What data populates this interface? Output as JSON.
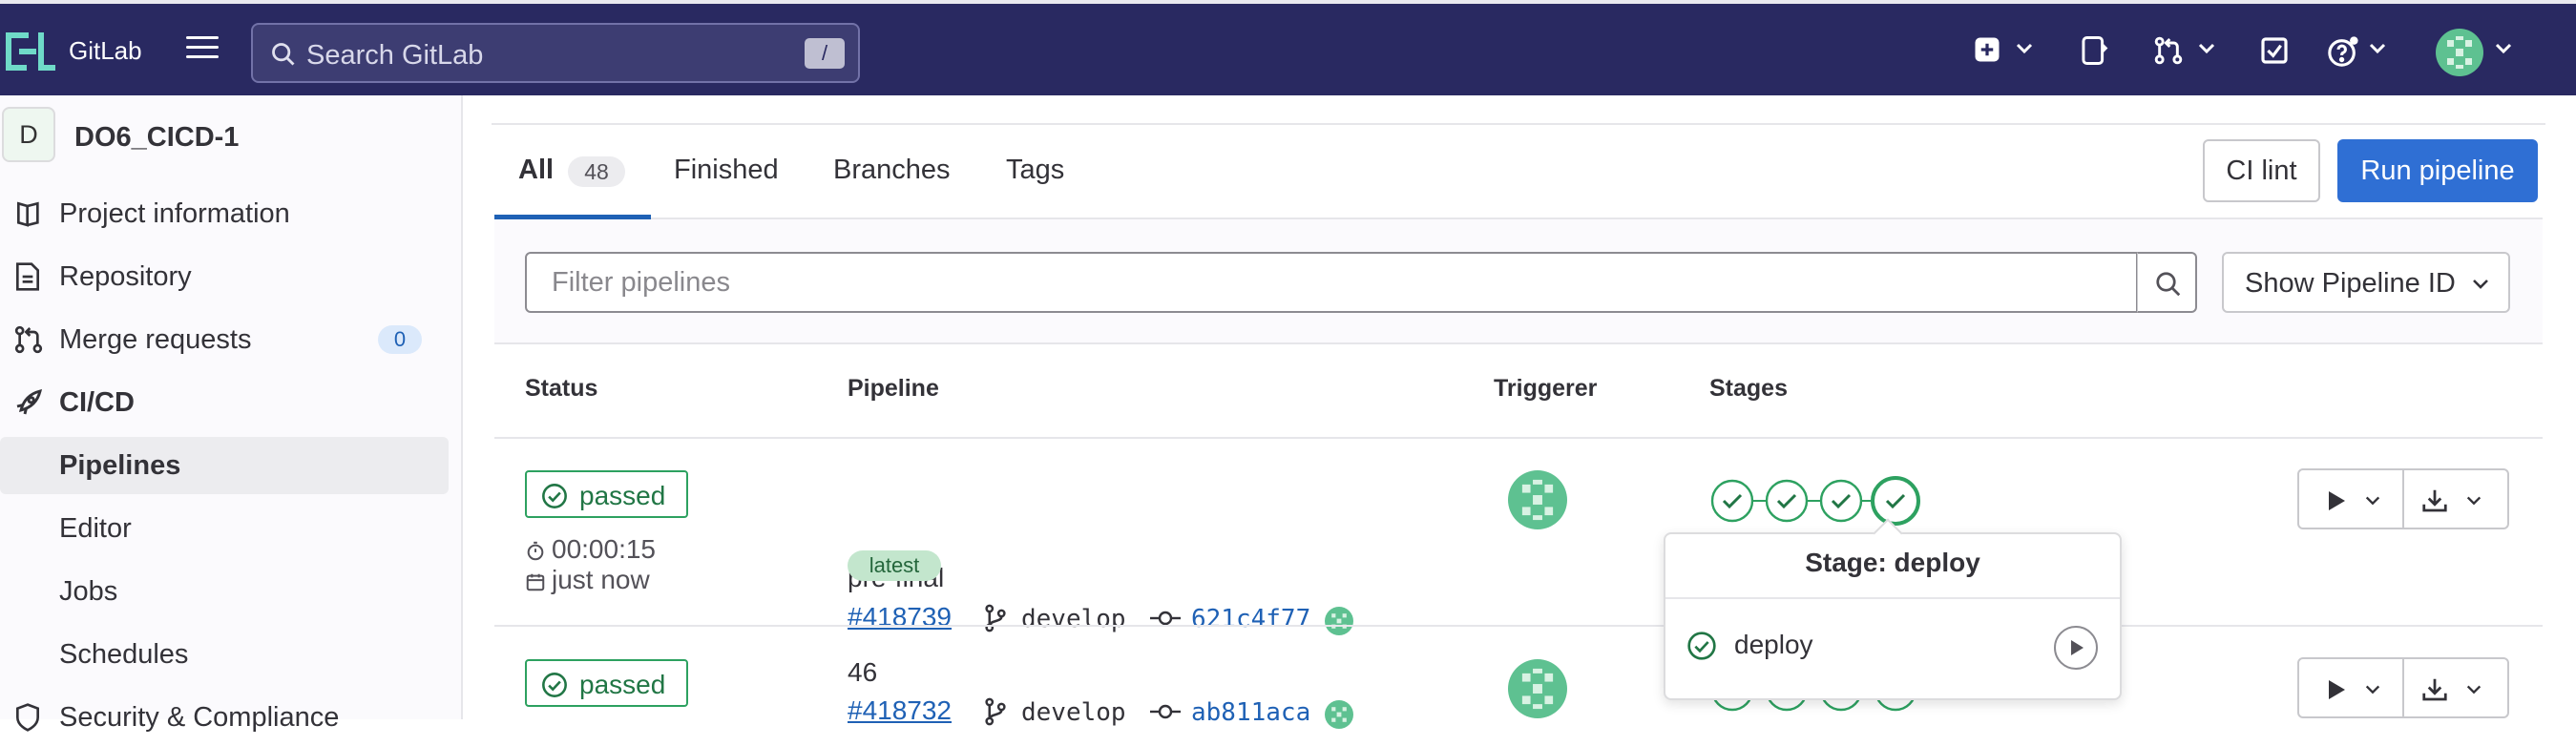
{
  "topbar": {
    "brand": "GitLab",
    "search_placeholder": "Search GitLab",
    "search_shortcut": "/",
    "icons": [
      "hamburger-icon",
      "search-icon",
      "plus-square-icon",
      "chevron-down-icon",
      "issues-icon",
      "merge-request-icon",
      "todo-icon",
      "help-icon",
      "user-avatar"
    ]
  },
  "sidebar": {
    "project_initial": "D",
    "project_name": "DO6_CICD-1",
    "items": [
      {
        "label": "Project information",
        "icon": "project-info-icon"
      },
      {
        "label": "Repository",
        "icon": "repository-icon"
      },
      {
        "label": "Merge requests",
        "icon": "merge-request-icon",
        "count": "0"
      },
      {
        "label": "CI/CD",
        "icon": "rocket-icon"
      },
      {
        "label": "Pipelines",
        "active": true
      },
      {
        "label": "Editor"
      },
      {
        "label": "Jobs"
      },
      {
        "label": "Schedules"
      },
      {
        "label": "Security & Compliance",
        "icon": "shield-icon"
      }
    ]
  },
  "tabs": [
    {
      "label": "All",
      "count": "48",
      "active": true
    },
    {
      "label": "Finished"
    },
    {
      "label": "Branches"
    },
    {
      "label": "Tags"
    }
  ],
  "actions": {
    "ci_lint": "CI lint",
    "run_pipeline": "Run pipeline"
  },
  "filter": {
    "placeholder": "Filter pipelines",
    "show_id": "Show Pipeline ID"
  },
  "table": {
    "headers": {
      "status": "Status",
      "pipeline": "Pipeline",
      "triggerer": "Triggerer",
      "stages": "Stages"
    },
    "rows": [
      {
        "status": "passed",
        "duration": "00:00:15",
        "finished": "just now",
        "title": "pre-final",
        "id": "#418739",
        "branch": "develop",
        "sha": "621c4f77",
        "label": "latest"
      },
      {
        "status": "passed",
        "title": "46",
        "id": "#418732",
        "branch": "develop",
        "sha": "ab811aca"
      }
    ]
  },
  "popover": {
    "title": "Stage: deploy",
    "job": "deploy"
  },
  "colors": {
    "nav": "#292961",
    "success": "#2da160",
    "link": "#1f61b5",
    "primary": "#2f6fd4"
  }
}
